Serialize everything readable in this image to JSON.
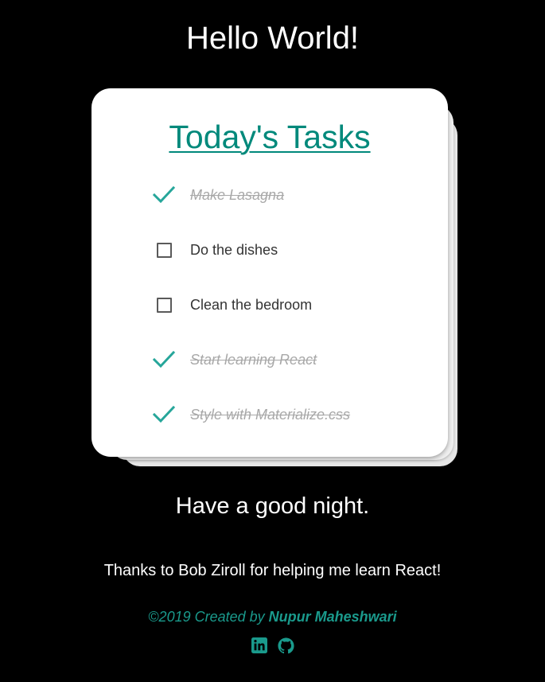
{
  "header": {
    "title": "Hello World!"
  },
  "todo": {
    "title": "Today's Tasks",
    "items": [
      {
        "label": "Make Lasagna",
        "completed": true
      },
      {
        "label": "Do the dishes",
        "completed": false
      },
      {
        "label": "Clean the bedroom",
        "completed": false
      },
      {
        "label": "Start learning React",
        "completed": true
      },
      {
        "label": "Style with Materialize.css",
        "completed": true
      }
    ]
  },
  "greeting": "Have a good night.",
  "thanks": "Thanks to Bob Ziroll for helping me learn React!",
  "footer": {
    "credit_prefix": "©2019 Created by ",
    "author": "Nupur Maheshwari",
    "socials": [
      {
        "icon": "linkedin-icon"
      },
      {
        "icon": "github-icon"
      }
    ]
  },
  "colors": {
    "accent": "#00897b",
    "footer_accent": "#1a9a8c",
    "background": "#000000",
    "card": "#ffffff",
    "completed_text": "#a8a8a8"
  }
}
